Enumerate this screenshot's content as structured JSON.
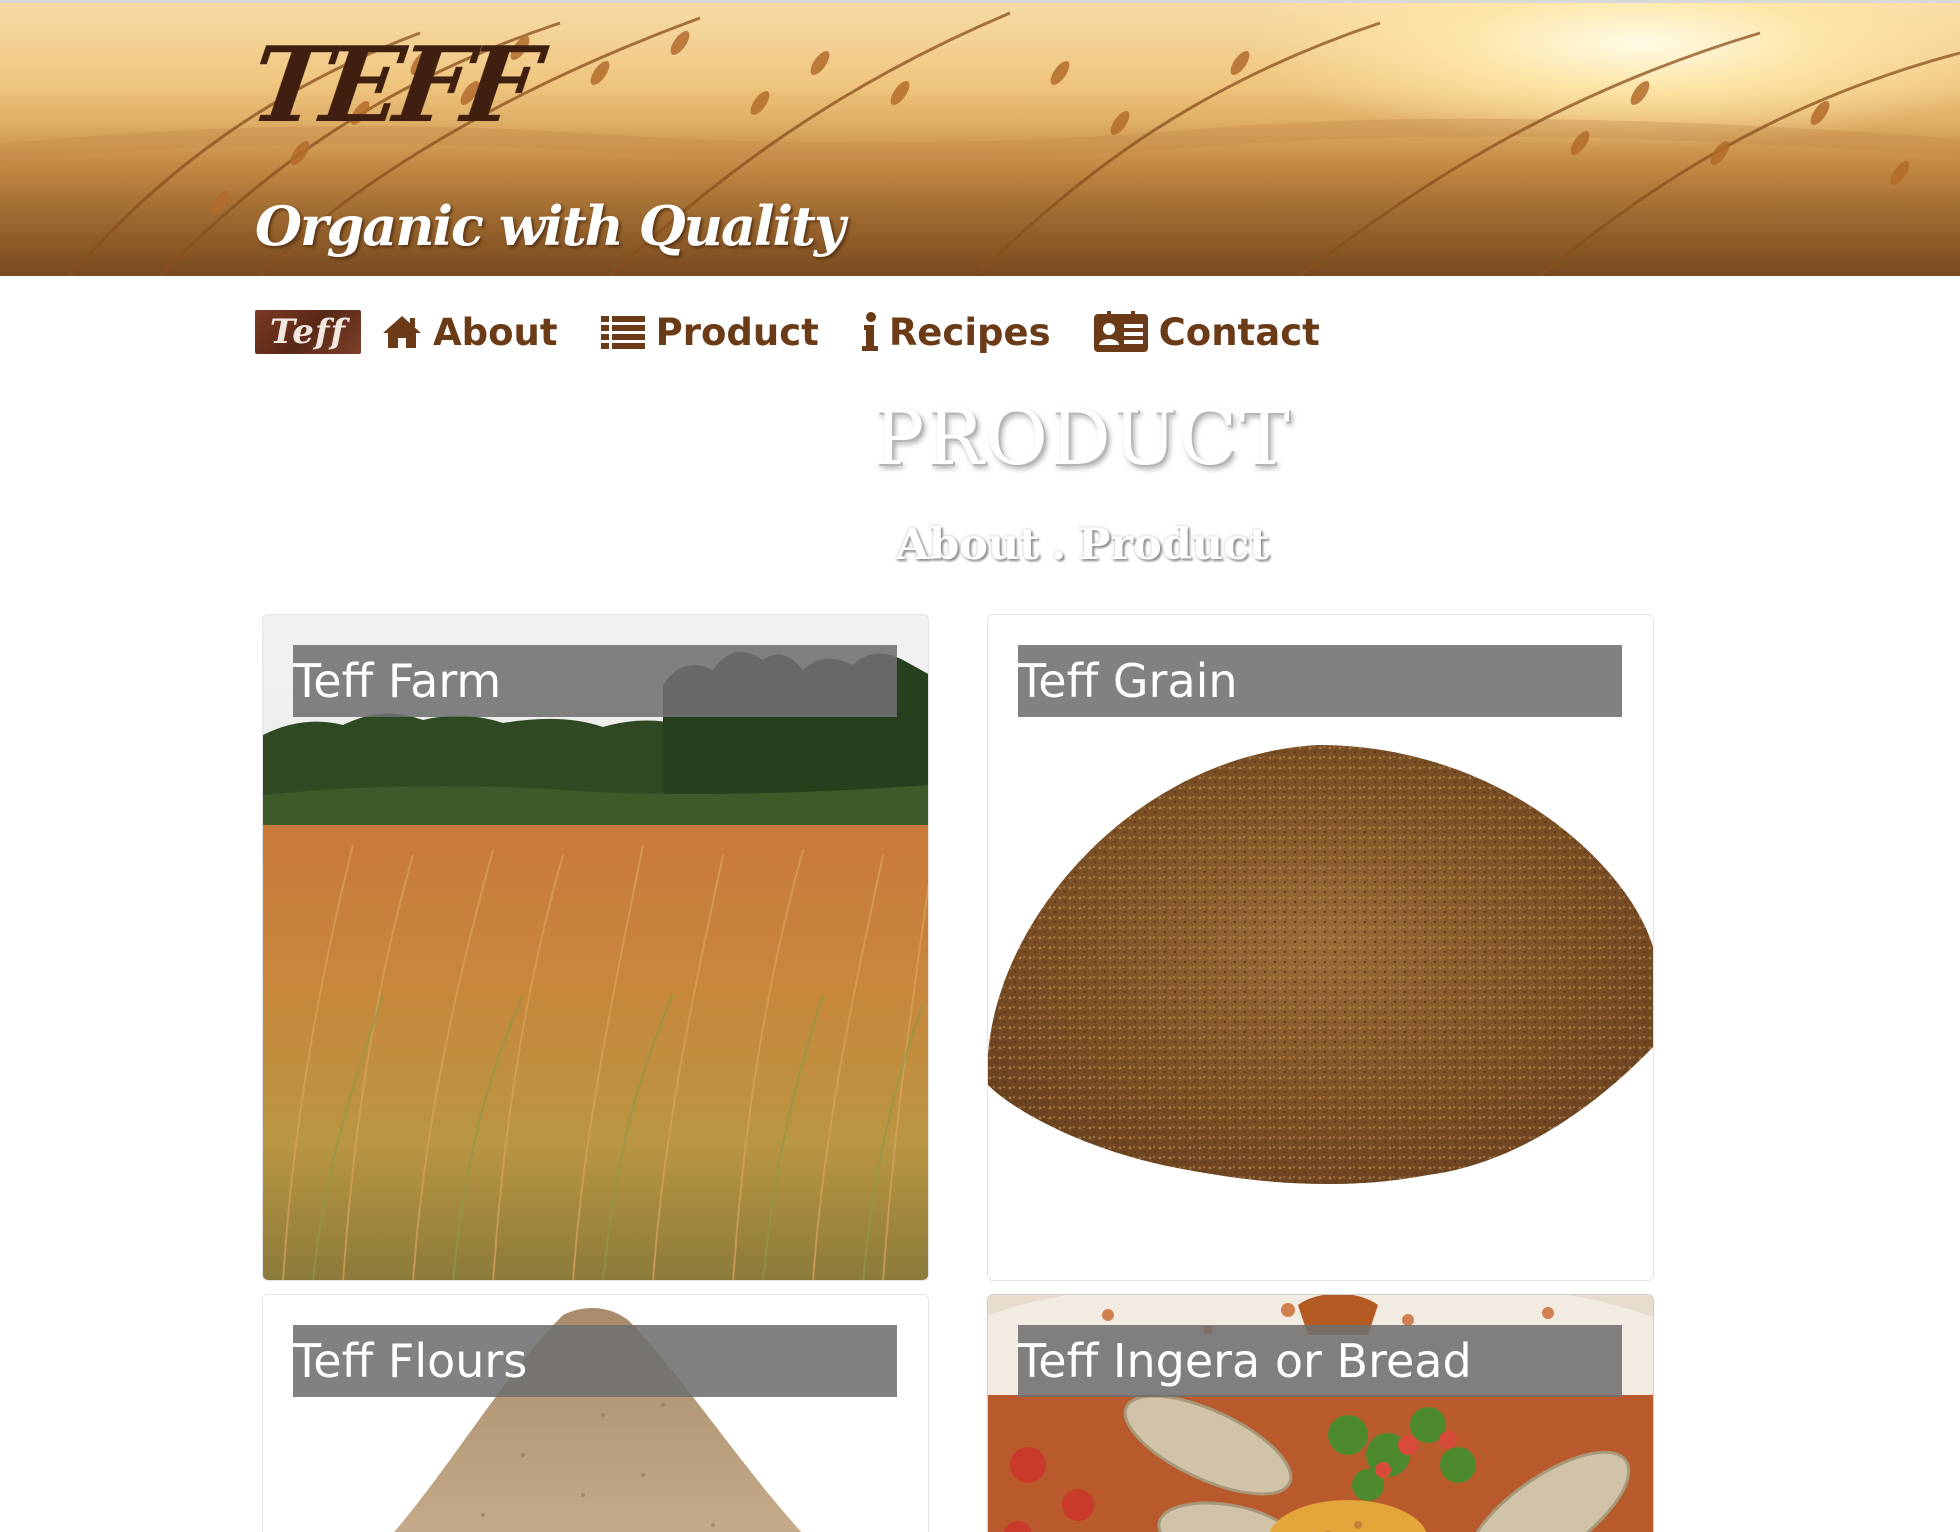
{
  "hero": {
    "title": "TEFF",
    "tagline": "Organic with Quality"
  },
  "nav": {
    "logo_text": "Teff",
    "items": [
      {
        "label": "About",
        "icon": "home-icon"
      },
      {
        "label": "Product",
        "icon": "list-icon"
      },
      {
        "label": "Recipes",
        "icon": "info-icon"
      },
      {
        "label": "Contact",
        "icon": "contact-card-icon"
      }
    ]
  },
  "page": {
    "heading": "PRODUCT",
    "breadcrumb": {
      "parent": "About",
      "separator": ".",
      "current": "Product"
    }
  },
  "products": [
    {
      "label": "Teff Farm",
      "image": "teff-farm-photo"
    },
    {
      "label": "Teff Grain",
      "image": "teff-grain-photo"
    },
    {
      "label": "Teff Flours",
      "image": "teff-flour-photo"
    },
    {
      "label": "Teff Ingera or Bread",
      "image": "injera-bread-photo"
    }
  ],
  "colors": {
    "brand_brown": "#6b3a16",
    "title_brown": "#3e1f10",
    "label_overlay": "#707070"
  }
}
